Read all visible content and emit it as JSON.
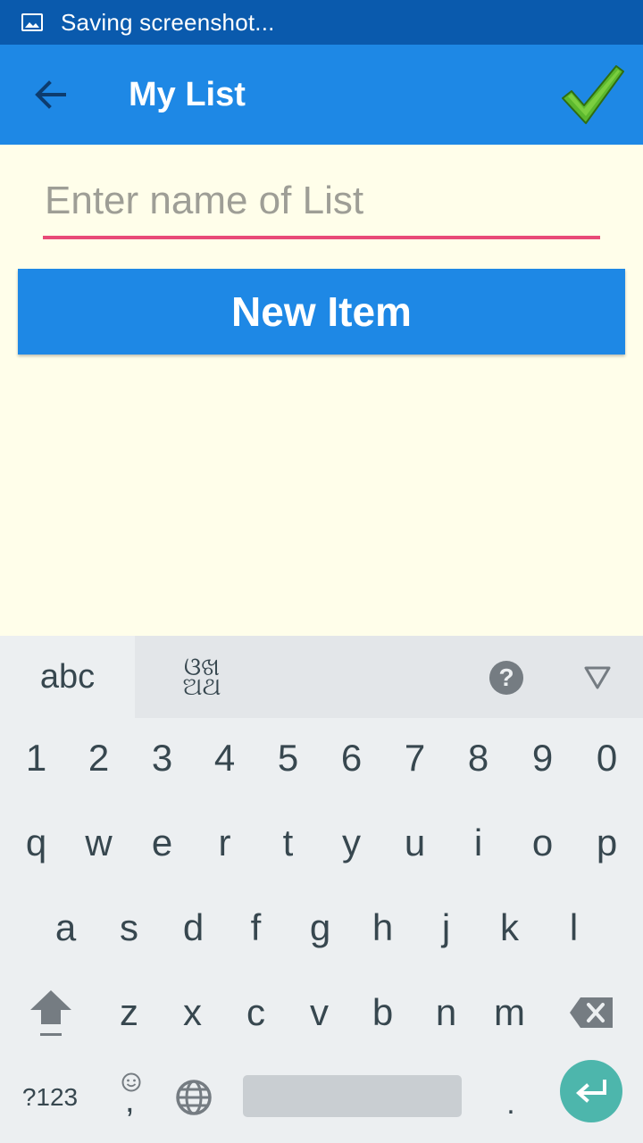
{
  "status_bar": {
    "icon": "image-icon",
    "text": "Saving screenshot..."
  },
  "app_bar": {
    "back_icon": "arrow-left-icon",
    "title": "My List",
    "confirm_icon": "checkmark-icon",
    "colors": {
      "background": "#1e88e5",
      "status": "#0a5aad",
      "check": "#5cb82e"
    }
  },
  "form": {
    "name_input": {
      "value": "",
      "placeholder": "Enter name of List"
    },
    "new_item_label": "New Item"
  },
  "keyboard": {
    "tabs": {
      "abc": "abc",
      "odia": "ଓଖ\nଅଥ"
    },
    "help_label": "?",
    "rows": {
      "numbers": [
        "1",
        "2",
        "3",
        "4",
        "5",
        "6",
        "7",
        "8",
        "9",
        "0"
      ],
      "row1": [
        "q",
        "w",
        "e",
        "r",
        "t",
        "y",
        "u",
        "i",
        "o",
        "p"
      ],
      "row2": [
        "a",
        "s",
        "d",
        "f",
        "g",
        "h",
        "j",
        "k",
        "l"
      ],
      "row3": [
        "z",
        "x",
        "c",
        "v",
        "b",
        "n",
        "m"
      ]
    },
    "symbols_label": "?123",
    "comma_label": ",",
    "period_label": "."
  }
}
